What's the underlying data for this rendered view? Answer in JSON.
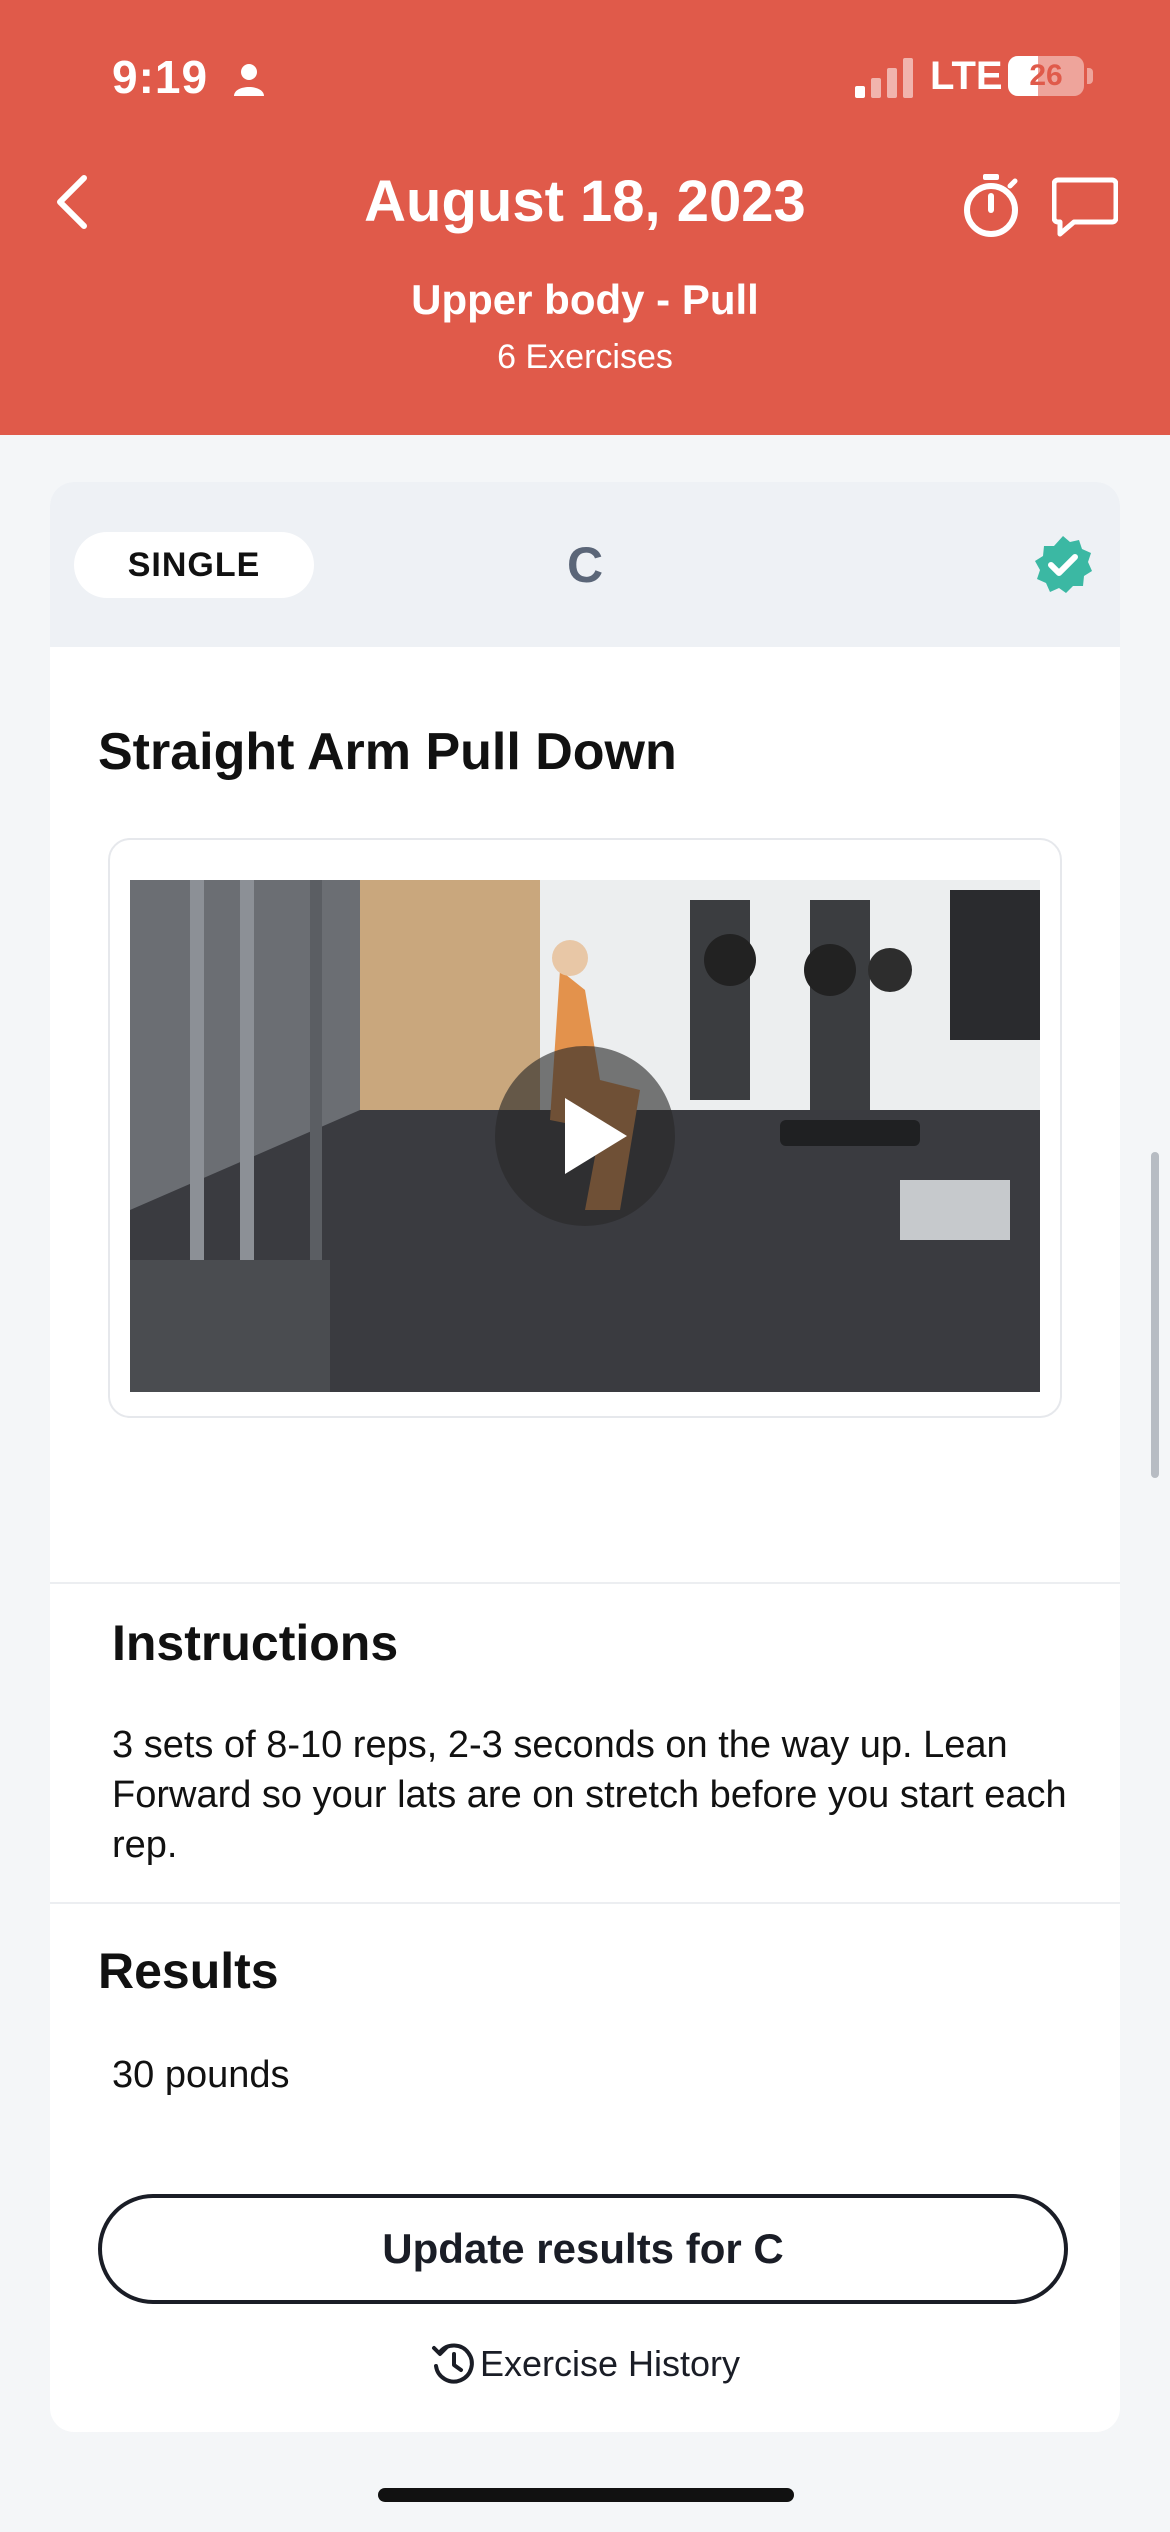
{
  "status_bar": {
    "time": "9:19",
    "carrier": "LTE",
    "battery": "26",
    "battery_level": 0.26
  },
  "header": {
    "title": "August 18, 2023",
    "workout_name": "Upper body - Pull",
    "exercise_count": "6 Exercises",
    "icons": [
      "back-arrow",
      "timer",
      "chat-bubble"
    ]
  },
  "exercise": {
    "type_badge": "SINGLE",
    "letter": "C",
    "completed": true,
    "title": "Straight Arm Pull Down"
  },
  "instructions": {
    "heading": "Instructions",
    "text": "3 sets of 8-10 reps, 2-3 seconds on the way up. Lean Forward so your lats are on stretch before you start each rep."
  },
  "results": {
    "heading": "Results",
    "value": "30 pounds",
    "update_button": "Update results for C",
    "history_link": "Exercise History"
  },
  "colors": {
    "header_bg": "#e05a4a",
    "card_top_bg": "#eef1f5",
    "check_green": "#3bb8a3",
    "button_border": "#1a1d26"
  }
}
